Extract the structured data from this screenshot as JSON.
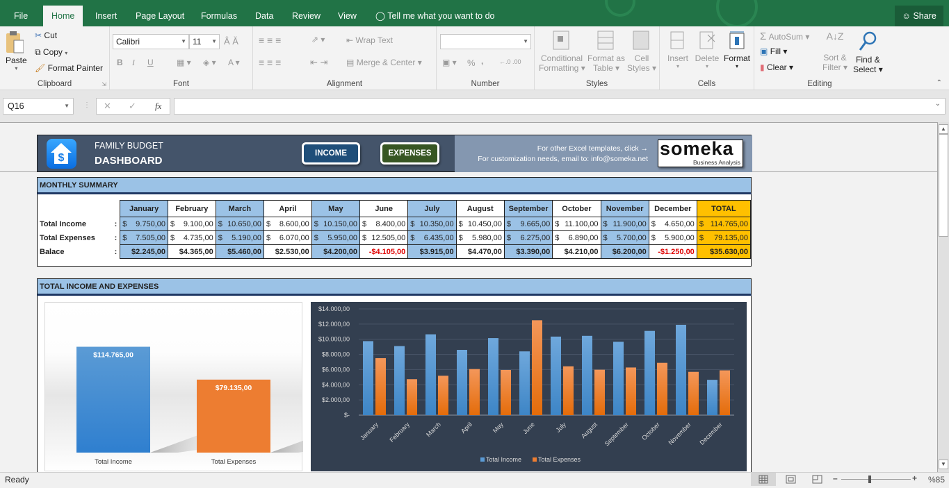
{
  "app": {
    "tabs": [
      "File",
      "Home",
      "Insert",
      "Page Layout",
      "Formulas",
      "Data",
      "Review",
      "View"
    ],
    "active_tab": "Home",
    "tell_me": "Tell me what you want to do",
    "share": "Share"
  },
  "ribbon": {
    "clipboard": {
      "label": "Clipboard",
      "paste": "Paste",
      "cut": "Cut",
      "copy": "Copy",
      "format_painter": "Format Painter"
    },
    "font": {
      "label": "Font",
      "font_name": "Calibri",
      "font_size": "11",
      "bold": "B",
      "italic": "I",
      "underline": "U"
    },
    "alignment": {
      "label": "Alignment",
      "wrap_text": "Wrap Text",
      "merge_center": "Merge & Center"
    },
    "number": {
      "label": "Number",
      "format_value": "",
      "percent": "%",
      "comma": ","
    },
    "styles": {
      "label": "Styles",
      "conditional_1": "Conditional",
      "conditional_2": "Formatting",
      "format_table_1": "Format as",
      "format_table_2": "Table",
      "cell_styles_1": "Cell",
      "cell_styles_2": "Styles"
    },
    "cells": {
      "label": "Cells",
      "insert": "Insert",
      "delete": "Delete",
      "format": "Format"
    },
    "editing": {
      "label": "Editing",
      "autosum": "AutoSum",
      "fill": "Fill",
      "clear": "Clear",
      "sort_1": "Sort &",
      "sort_2": "Filter",
      "find_1": "Find &",
      "find_2": "Select"
    }
  },
  "formula_bar": {
    "name_box": "Q16",
    "fx": "fx",
    "formula": ""
  },
  "banner": {
    "subtitle": "FAMILY BUDGET",
    "title": "DASHBOARD",
    "income_btn": "INCOME",
    "expenses_btn": "EXPENSES",
    "info_line1": "For other Excel templates, click →",
    "info_line2": "For customization needs, email to: info@someka.net",
    "logo_text": "someka",
    "logo_sub": "Business Analysis"
  },
  "summary": {
    "title": "MONTHLY SUMMARY",
    "months": [
      "January",
      "February",
      "March",
      "April",
      "May",
      "June",
      "July",
      "August",
      "September",
      "October",
      "November",
      "December"
    ],
    "total_label": "TOTAL",
    "rows": [
      {
        "label": "Total Income",
        "colon": ":",
        "values": [
          "9.750,00",
          "9.100,00",
          "10.650,00",
          "8.600,00",
          "10.150,00",
          "8.400,00",
          "10.350,00",
          "10.450,00",
          "9.665,00",
          "11.100,00",
          "11.900,00",
          "4.650,00"
        ],
        "total": "114.765,00"
      },
      {
        "label": "Total Expenses",
        "colon": ":",
        "values": [
          "7.505,00",
          "4.735,00",
          "5.190,00",
          "6.070,00",
          "5.950,00",
          "12.505,00",
          "6.435,00",
          "5.980,00",
          "6.275,00",
          "6.890,00",
          "5.700,00",
          "5.900,00"
        ],
        "total": "79.135,00"
      }
    ],
    "balance": {
      "label": "Balace",
      "colon": ":",
      "values": [
        "$2.245,00",
        "$4.365,00",
        "$5.460,00",
        "$2.530,00",
        "$4.200,00",
        "-$4.105,00",
        "$3.915,00",
        "$4.470,00",
        "$3.390,00",
        "$4.210,00",
        "$6.200,00",
        "-$1.250,00"
      ],
      "total": "$35.630,00"
    },
    "currency": "$"
  },
  "section2": {
    "title": "TOTAL INCOME AND EXPENSES"
  },
  "chart_data": [
    {
      "type": "bar",
      "title": "",
      "categories": [
        "Total Income",
        "Total Expenses"
      ],
      "values": [
        114765,
        79135
      ],
      "data_labels": [
        "$114.765,00",
        "$79.135,00"
      ],
      "colors": [
        "#4a8ed1",
        "#ed7d31"
      ],
      "ylim": [
        0,
        140000
      ],
      "grid": false,
      "legend": "none"
    },
    {
      "type": "bar",
      "title": "",
      "categories": [
        "January",
        "February",
        "March",
        "April",
        "May",
        "June",
        "July",
        "August",
        "September",
        "October",
        "November",
        "December"
      ],
      "series": [
        {
          "name": "Total Income",
          "color": "#5b9bd5",
          "values": [
            9750,
            9100,
            10650,
            8600,
            10150,
            8400,
            10350,
            10450,
            9665,
            11100,
            11900,
            4650
          ]
        },
        {
          "name": "Total Expenses",
          "color": "#ed7d31",
          "values": [
            7505,
            4735,
            5190,
            6070,
            5950,
            12505,
            6435,
            5980,
            6275,
            6890,
            5700,
            5900
          ]
        }
      ],
      "yticks": [
        0,
        2000,
        4000,
        6000,
        8000,
        10000,
        12000,
        14000
      ],
      "ytick_labels": [
        "$-",
        "$2.000,00",
        "$4.000,00",
        "$6.000,00",
        "$8.000,00",
        "$10.000,00",
        "$12.000,00",
        "$14.000,00"
      ],
      "ylim": [
        0,
        14000
      ],
      "grid": true,
      "legend": "bottom",
      "xlabel": "",
      "ylabel": ""
    }
  ],
  "status": {
    "ready": "Ready",
    "zoom": "%85"
  }
}
